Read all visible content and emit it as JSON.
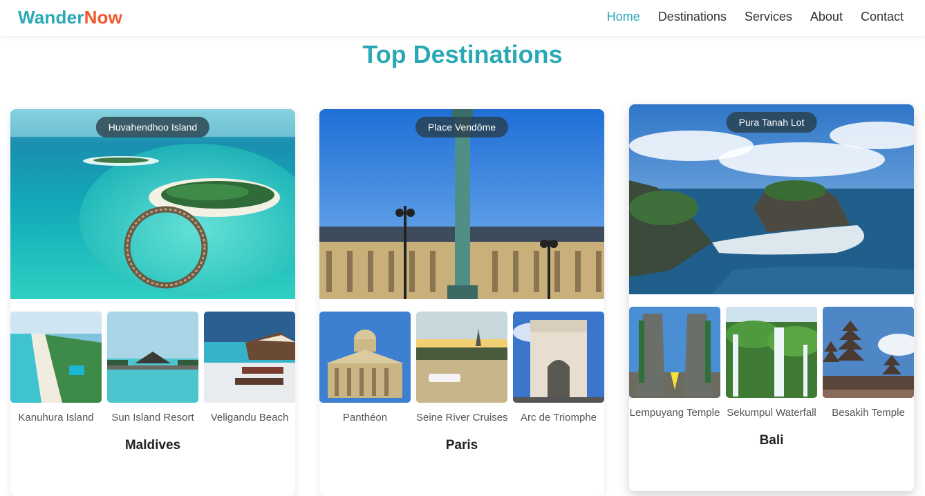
{
  "brand": {
    "part1": "Wander",
    "part2": "Now"
  },
  "nav": {
    "items": [
      "Home",
      "Destinations",
      "Services",
      "About",
      "Contact"
    ],
    "active": "Home"
  },
  "section": {
    "title": "Top Destinations"
  },
  "cards": [
    {
      "name": "Maldives",
      "hero_label": "Huvahendhoo Island",
      "thumbs": [
        {
          "label": "Kanuhura Island"
        },
        {
          "label": "Sun Island Resort"
        },
        {
          "label": "Veligandu Beach"
        }
      ]
    },
    {
      "name": "Paris",
      "hero_label": "Place Vendôme",
      "thumbs": [
        {
          "label": "Panthéon"
        },
        {
          "label": "Seine River Cruises"
        },
        {
          "label": "Arc de Triomphe"
        }
      ]
    },
    {
      "name": "Bali",
      "hero_label": "Pura Tanah Lot",
      "thumbs": [
        {
          "label": "Lempuyang Temple"
        },
        {
          "label": "Sekumpul Waterfall"
        },
        {
          "label": "Besakih Temple"
        }
      ]
    }
  ],
  "colors": {
    "accent": "#2aa9b5",
    "brand_orange": "#f0582a",
    "text": "#333333"
  }
}
